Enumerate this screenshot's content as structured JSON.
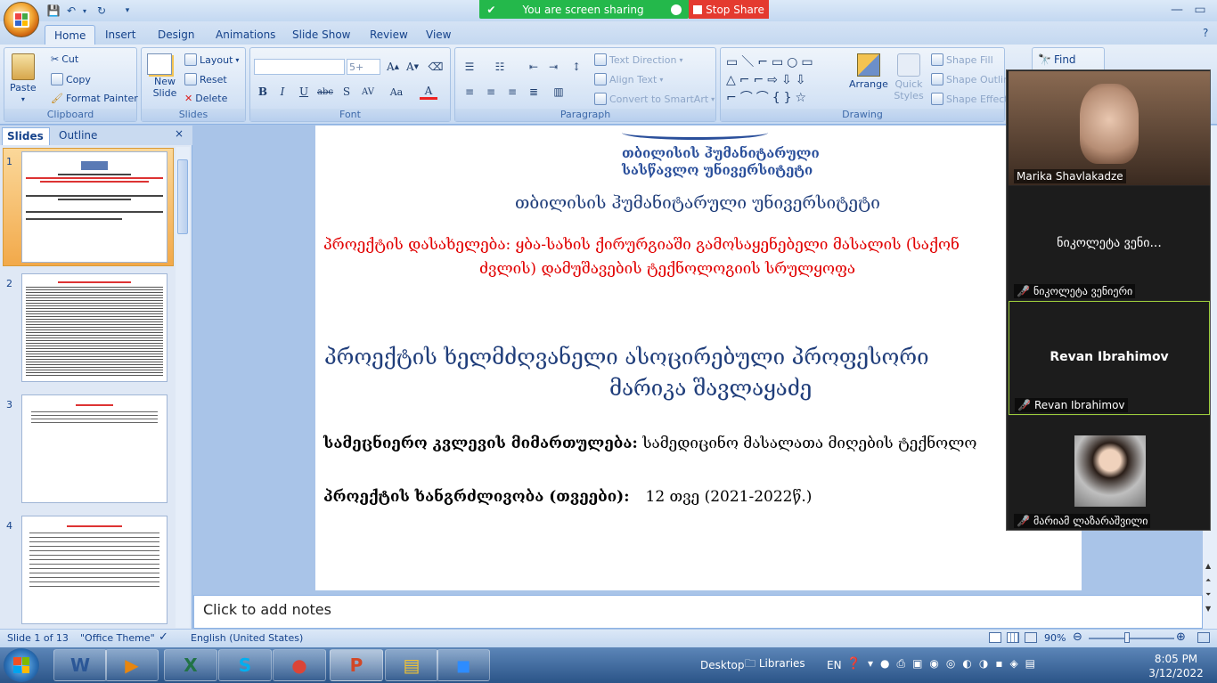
{
  "title_bar": {
    "share_status": "You are screen sharing",
    "stop_share": "Stop Share"
  },
  "tabs": [
    "Home",
    "Insert",
    "Design",
    "Animations",
    "Slide Show",
    "Review",
    "View"
  ],
  "ribbon": {
    "clipboard": {
      "label": "Clipboard",
      "paste": "Paste",
      "cut": "Cut",
      "copy": "Copy",
      "format_painter": "Format Painter"
    },
    "slides": {
      "label": "Slides",
      "new_slide": "New Slide",
      "layout": "Layout",
      "reset": "Reset",
      "delete": "Delete"
    },
    "font": {
      "label": "Font",
      "size_value": "5+"
    },
    "paragraph": {
      "label": "Paragraph",
      "text_direction": "Text Direction",
      "align_text": "Align Text",
      "convert_smartart": "Convert to SmartArt"
    },
    "drawing": {
      "label": "Drawing",
      "arrange": "Arrange",
      "quick_styles": "Quick Styles",
      "shape_fill": "Shape Fill",
      "shape_outline": "Shape Outline",
      "shape_effects": "Shape Effects"
    },
    "editing": {
      "find": "Find"
    }
  },
  "slide_panel": {
    "tab_slides": "Slides",
    "tab_outline": "Outline",
    "close": "×",
    "numbers": [
      "1",
      "2",
      "3",
      "4"
    ]
  },
  "slide": {
    "logo_line1": "თბილისის ჰუმანიტარული",
    "logo_line2": "სასწავლო უნივერსიტეტი",
    "university": "თბილისის ჰუმანიტარული უნივერსიტეტი",
    "project_title_line1": "პროექტის დასახელება: ყბა-სახის ქირურგიაში გამოსაყენებელი მასალის (საქონ",
    "project_title_line2": "ძვლის) დამუშავების ტექნოლოგიის სრულყოფა",
    "leader_line1": "პროექტის ხელმძღვანელი ასოცირებული პროფესორი",
    "leader_line2": "მარიკა შავლაყაძე",
    "direction_label": "სამეცნიერო კვლევის მიმართულება:",
    "direction_value": " სამედიცინო მასალათა მიღების ტექნოლო",
    "duration_label": "პროექტის ხანგრძლივობა (თვეები):",
    "duration_value": "12 თვე (2021-2022წ.)"
  },
  "notes_placeholder": "Click to add notes",
  "status_bar": {
    "slide_of": "Slide 1 of 13",
    "theme": "\"Office Theme\"",
    "language": "English (United States)",
    "zoom": "90%"
  },
  "zoom_participants": [
    {
      "name": "Marika Shavlakadze",
      "display": "",
      "muted": false
    },
    {
      "name": "ნიკოლეტა ვენიერი",
      "display": "ნიკოლეტა ვენი...",
      "muted": true
    },
    {
      "name": "Revan Ibrahimov",
      "display": "Revan Ibrahimov",
      "muted": true
    },
    {
      "name": "მარიამ ლაზარაშვილი",
      "display": "",
      "muted": true
    }
  ],
  "taskbar": {
    "desktop": "Desktop",
    "libraries": "Libraries",
    "lang": "EN",
    "time": "8:05 PM",
    "date": "3/12/2022"
  },
  "colors": {
    "slide_title_blue": "#1f3d7a",
    "slide_red": "#e10000",
    "share_green": "#24b84b",
    "stop_red": "#e43a2f"
  }
}
